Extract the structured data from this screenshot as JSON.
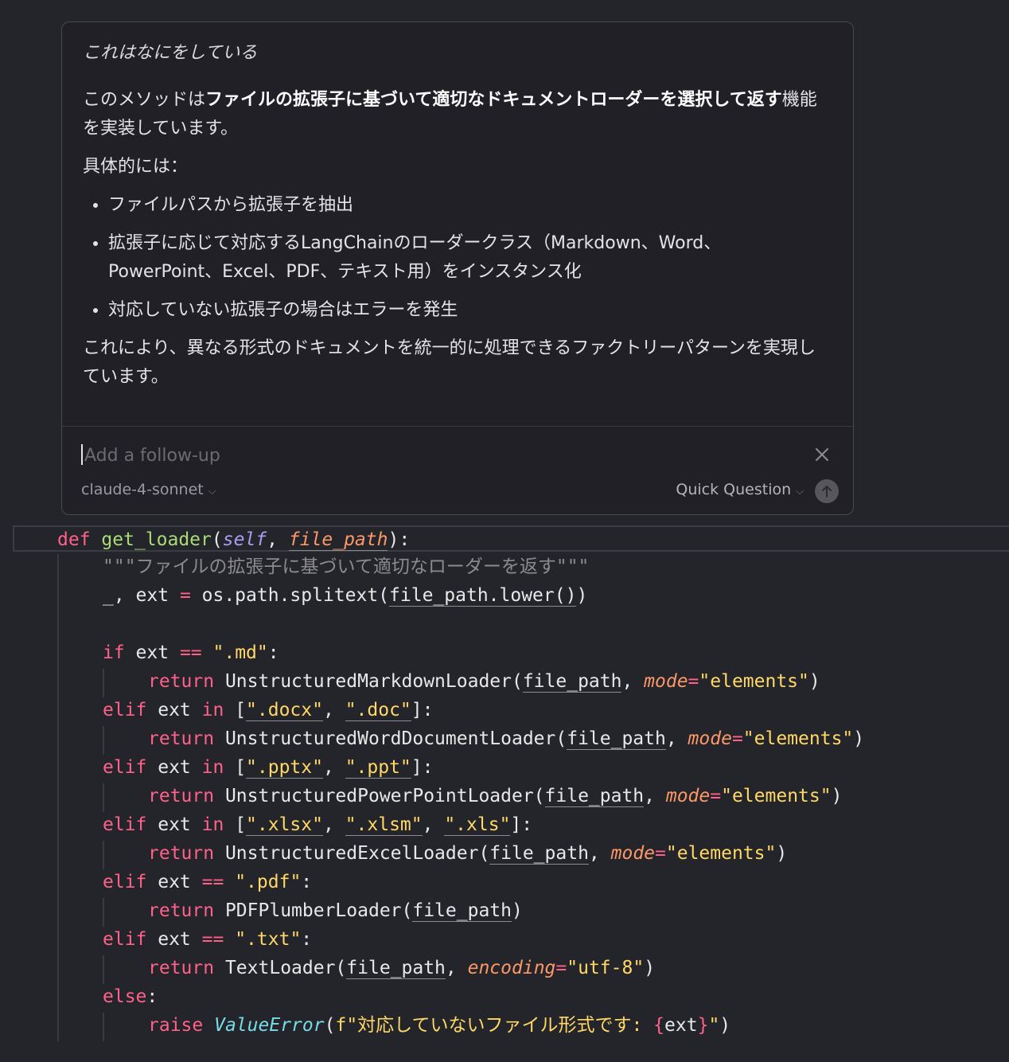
{
  "chat": {
    "question": "これはなにをしている",
    "answer": {
      "p1_pre": "このメソッドは",
      "p1_bold": "ファイルの拡張子に基づいて適切なドキュメントローダーを選択して返す",
      "p1_post": "機能を実装しています。",
      "p2": "具体的には：",
      "bullets": [
        "ファイルパスから拡張子を抽出",
        "拡張子に応じて対応するLangChainのローダークラス（Markdown、Word、PowerPoint、Excel、PDF、テキスト用）をインスタンス化",
        "対応していない拡張子の場合はエラーを発生"
      ],
      "p3": "これにより、異なる形式のドキュメントを統一的に処理できるファクトリーパターンを実現しています。"
    },
    "input": {
      "placeholder": "Add a follow-up",
      "value": ""
    },
    "model": "claude-4-sonnet",
    "mode": "Quick Question",
    "icons": {
      "close": "close-icon",
      "send": "arrow-up-icon",
      "chevron": "chevron-down-icon"
    }
  },
  "code": {
    "def": "def",
    "func_name": "get_loader",
    "self": "self",
    "param_file_path": "file_path",
    "docstring": "\"\"\"ファイルの拡張子に基づいて適切なローダーを返す\"\"\"",
    "split_line_pre": "_, ext ",
    "eq": "=",
    "split_call": " os.path.splitext(",
    "split_arg": "file_path.lower()",
    "close_paren": ")",
    "kw_if": "if",
    "kw_elif": "elif",
    "kw_else": "else",
    "kw_return": "return",
    "kw_in": "in",
    "kw_raise": "raise",
    "op_eqeq": "==",
    "var_ext": " ext ",
    "ext_md": "\".md\"",
    "ext_docx": "\".docx\"",
    "ext_doc": "\".doc\"",
    "ext_pptx": "\".pptx\"",
    "ext_ppt": "\".ppt\"",
    "ext_xlsx": "\".xlsx\"",
    "ext_xlsm": "\".xlsm\"",
    "ext_xls": "\".xls\"",
    "ext_pdf": "\".pdf\"",
    "ext_txt": "\".txt\"",
    "loader_md": "UnstructuredMarkdownLoader(",
    "loader_word": "UnstructuredWordDocumentLoader(",
    "loader_ppt": "UnstructuredPowerPointLoader(",
    "loader_excel": "UnstructuredExcelLoader(",
    "loader_pdf": "PDFPlumberLoader(",
    "loader_txt": "TextLoader(",
    "arg_file_path": "file_path",
    "kw_mode": "mode",
    "val_elements": "\"elements\"",
    "kw_encoding": "encoding",
    "val_utf8": "\"utf-8\"",
    "error_class": "ValueError",
    "fstring_prefix": "f",
    "fstring_text": "\"対応していないファイル形式です: ",
    "fstring_var_open": "{",
    "fstring_var": "ext",
    "fstring_var_close": "}",
    "fstring_end": "\""
  }
}
